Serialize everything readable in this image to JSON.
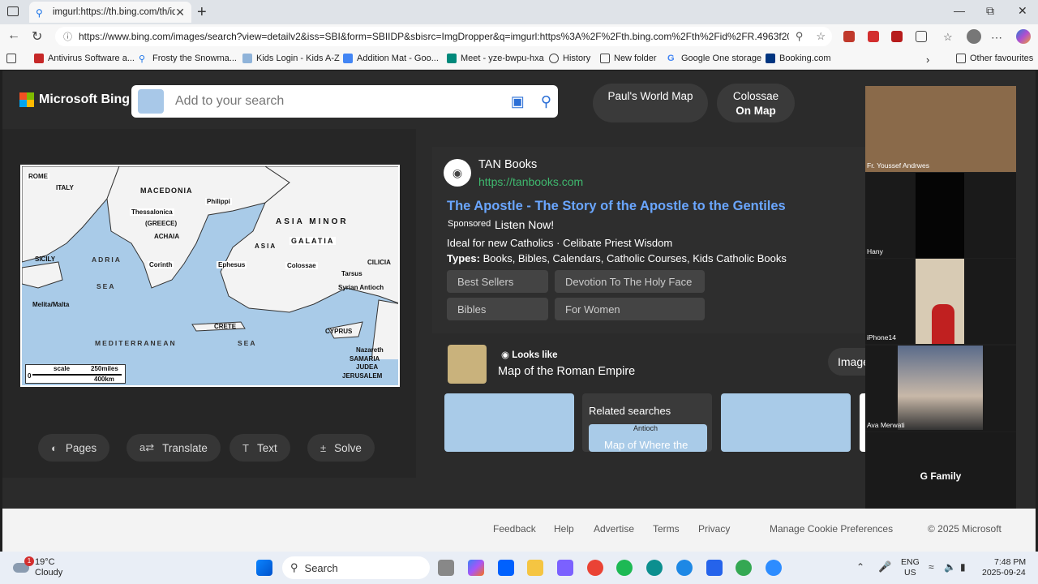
{
  "browser": {
    "tab_title": "imgurl:https://th.bing.com/th/id/I",
    "url": "https://www.bing.com/images/search?view=detailv2&iss=SBI&form=SBIIDP&sbisrc=ImgDropper&q=imgurl:https%3A%2F%2Fth.bing.com%2Fth%2Fid%2FR.4963f20dc..."
  },
  "bookmarks": [
    "Antivirus Software a...",
    "Frosty the Snowma...",
    "Kids Login - Kids A-Z",
    "Addition Mat - Goo...",
    "Meet - yze-bwpu-hxa",
    "History",
    "New folder",
    "Google One storage",
    "Booking.com",
    "Other favourites"
  ],
  "bing": {
    "logo": "Microsoft Bing",
    "search_placeholder": "Add to your search",
    "pill1": "Paul's World Map",
    "pill2_line1": "Colossae",
    "pill2_line2": "On Map"
  },
  "map_labels": {
    "rome": "ROME",
    "italy": "ITALY",
    "macedonia": "MACEDONIA",
    "philippi": "Philippi",
    "thessalonica": "Thessalonica",
    "greece": "(GREECE)",
    "achaia": "ACHAIA",
    "asia_minor": "ASIA MINOR",
    "galatia": "GALATIA",
    "asia": "ASIA",
    "sicily": "SICILY",
    "adria": "ADRIA",
    "corinth": "Corinth",
    "ephesus": "Ephesus",
    "colossae": "Colossae",
    "tarsus": "Tarsus",
    "cilicia": "CILICIA",
    "syrian_antioch": "Syrian Antioch",
    "sea": "SEA",
    "melita": "Melita/Malta",
    "crete": "CRETE",
    "cyprus": "CYPRUS",
    "mediterranean": "MEDITERRANEAN",
    "sea2": "SEA",
    "nazareth": "Nazareth",
    "samaria": "SAMARIA",
    "judea": "JUDEA",
    "jerusalem": "JERUSALEM",
    "scale": "scale",
    "miles": "250miles",
    "km": "400km",
    "zero": "0"
  },
  "tools": [
    "Pages",
    "Translate",
    "Text",
    "Solve"
  ],
  "ad": {
    "brand": "TAN Books",
    "brand_url": "https://tanbooks.com",
    "title": "The Apostle - The Story of the Apostle to the Gentiles",
    "sponsored": "Sponsored",
    "listen": "Listen Now!",
    "line": "Ideal for new Catholics · Celibate Priest Wisdom",
    "types_label": "Types:",
    "types": "Books, Bibles, Calendars, Catholic Courses, Kids Catholic Books",
    "chips": [
      "Best Sellers",
      "Devotion To The Holy Face",
      "Bibles",
      "For Women"
    ]
  },
  "looks_like": {
    "label": "Looks like",
    "title": "Map of the Roman Empire",
    "image_button": "Image"
  },
  "related": {
    "title": "Related searches",
    "item": "Map of Where the",
    "map_tag": "Antioch"
  },
  "call": {
    "participants": [
      "Fr. Youssef Andrwes",
      "Hany",
      "iPhone14",
      "Ava Merwati",
      "G Family"
    ]
  },
  "footer": [
    "Feedback",
    "Help",
    "Advertise",
    "Terms",
    "Privacy",
    "Manage Cookie Preferences",
    "© 2025 Microsoft"
  ],
  "taskbar": {
    "weather_temp": "19°C",
    "weather_desc": "Cloudy",
    "weather_badge": "1",
    "search": "Search",
    "lang1": "ENG",
    "lang2": "US",
    "time": "7:48 PM",
    "date": "2025-09-24"
  }
}
